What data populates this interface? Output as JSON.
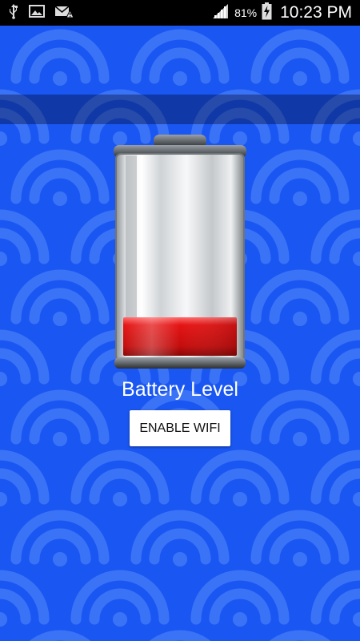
{
  "status_bar": {
    "battery_percent": "81%",
    "time": "10:23 PM",
    "icons": [
      "usb-icon",
      "image-icon",
      "email-alert-icon",
      "signal-icon",
      "battery-charging-icon"
    ]
  },
  "main": {
    "battery_label": "Battery Level",
    "battery_fill_fraction": 0.2,
    "button_label": "ENABLE WIFI"
  },
  "colors": {
    "background": "#1a57f2",
    "pattern": "#3b73f7",
    "battery_fill": "#e31414"
  }
}
